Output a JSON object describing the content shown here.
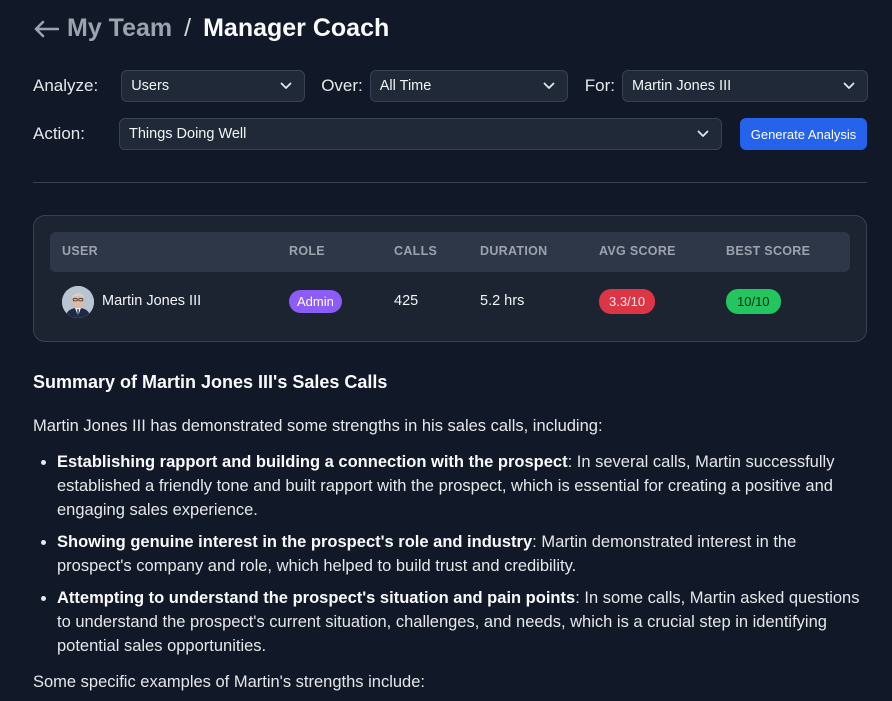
{
  "header": {
    "back_label": "My Team",
    "separator": "/",
    "title": "Manager Coach"
  },
  "filters": {
    "analyze": {
      "label": "Analyze:",
      "value": "Users"
    },
    "over": {
      "label": "Over:",
      "value": "All Time"
    },
    "for": {
      "label": "For:",
      "value": "Martin Jones III"
    },
    "action": {
      "label": "Action:",
      "value": "Things Doing Well"
    },
    "generate_label": "Generate Analysis"
  },
  "table": {
    "columns": [
      "USER",
      "ROLE",
      "CALLS",
      "DURATION",
      "AVG SCORE",
      "BEST SCORE"
    ],
    "row": {
      "user": "Martin Jones III",
      "role": "Admin",
      "calls": "425",
      "duration": "5.2 hrs",
      "avg_score": "3.3/10",
      "best_score": "10/10"
    }
  },
  "colors": {
    "accent": "#2563eb",
    "admin_badge": "#8b5cf6",
    "avg_badge": "#dc3545",
    "best_badge": "#22c55e"
  },
  "summary": {
    "heading": "Summary of Martin Jones III's Sales Calls",
    "intro": "Martin Jones III has demonstrated some strengths in his sales calls, including:",
    "points": [
      {
        "title": "Establishing rapport and building a connection with the prospect",
        "text": ": In several calls, Martin successfully established a friendly tone and built rapport with the prospect, which is essential for creating a positive and engaging sales experience."
      },
      {
        "title": "Showing genuine interest in the prospect's role and industry",
        "text": ": Martin demonstrated interest in the prospect's company and role, which helped to build trust and credibility."
      },
      {
        "title": "Attempting to understand the prospect's situation and pain points",
        "text": ": In some calls, Martin asked questions to understand the prospect's current situation, challenges, and needs, which is a crucial step in identifying potential sales opportunities."
      }
    ],
    "outro": "Some specific examples of Martin's strengths include:"
  }
}
